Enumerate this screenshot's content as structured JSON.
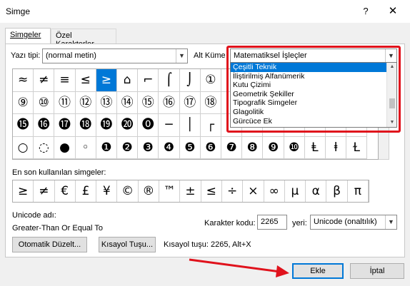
{
  "window": {
    "title": "Simge",
    "help": "?",
    "close": "✕"
  },
  "tabs": [
    {
      "label": "Simgeler",
      "active": true
    },
    {
      "label": "Özel Karakterler",
      "active": false
    }
  ],
  "font": {
    "label": "Yazı tipi:",
    "value": "(normal metin)"
  },
  "subset": {
    "label": "Alt Küme",
    "value": "Matematiksel İşleçler"
  },
  "subset_options": [
    "Çeşitli Teknik",
    "İliştirilmiş Alfanümerik",
    "Kutu Çizimi",
    "Geometrik Şekiller",
    "Tipografik Simgeler",
    "Glagolitik",
    "Gürcüce Ek"
  ],
  "symbol_grid": [
    [
      "≈",
      "≠",
      "≡",
      "≤",
      "≥",
      "⌂",
      "⌐",
      "⌠",
      "⌡",
      "①",
      "",
      "",
      "",
      "",
      "",
      "",
      ""
    ],
    [
      "⑨",
      "⑩",
      "⑪",
      "⑫",
      "⑬",
      "⑭",
      "⑮",
      "⑯",
      "⑰",
      "⑱",
      "",
      "",
      "",
      "",
      "",
      "",
      ""
    ],
    [
      "⓯",
      "⓰",
      "⓱",
      "⓲",
      "⓳",
      "⓴",
      "⓿",
      "─",
      "│",
      "┌",
      "",
      "",
      "",
      "",
      "",
      "",
      ""
    ],
    [
      "○",
      "◌",
      "●",
      "◦",
      "❶",
      "❷",
      "❸",
      "❹",
      "❺",
      "❻",
      "❼",
      "❽",
      "❾",
      "❿",
      "Ⱡ",
      "ⱡ",
      "Ɫ"
    ]
  ],
  "recent": {
    "label": "En son kullanılan simgeler:",
    "symbols": [
      "≥",
      "≠",
      "€",
      "£",
      "¥",
      "©",
      "®",
      "™",
      "±",
      "≤",
      "÷",
      "×",
      "∞",
      "µ",
      "α",
      "β",
      "π"
    ]
  },
  "unicode": {
    "label": "Unicode adı:",
    "name": "Greater-Than Or Equal To"
  },
  "char_code": {
    "label": "Karakter kodu:",
    "value": "2265"
  },
  "from": {
    "label": "yeri:",
    "value": "Unicode (onaltılık)"
  },
  "buttons": {
    "autocorrect": "Otomatik Düzelt...",
    "shortcut_key": "Kısayol Tuşu...",
    "insert": "Ekle",
    "cancel": "İptal"
  },
  "shortcut_text": "Kısayol tuşu: 2265, Alt+X",
  "colors": {
    "accent": "#0078d7",
    "annotation": "#e0121c"
  }
}
